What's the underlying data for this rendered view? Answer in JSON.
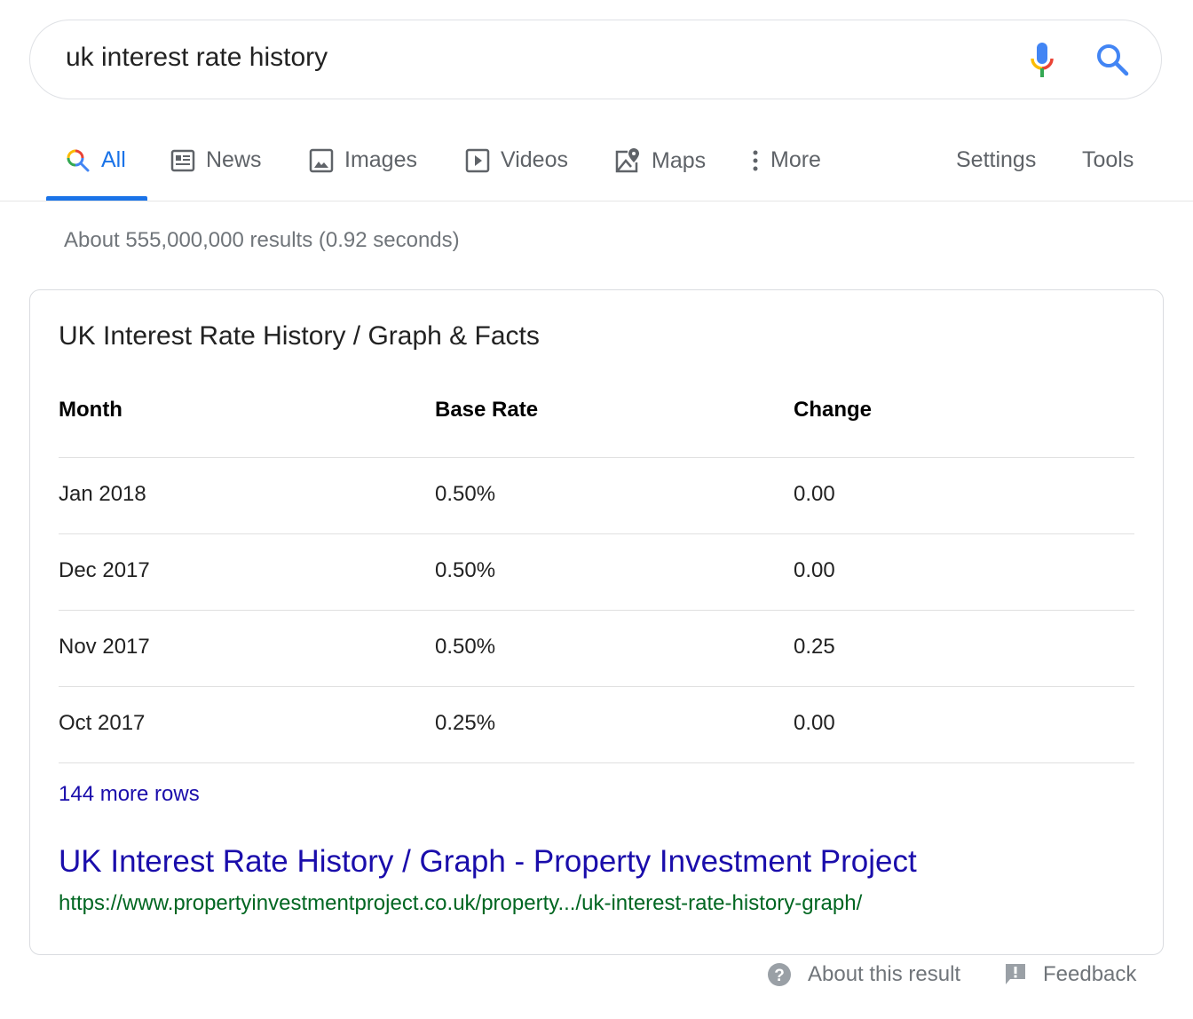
{
  "search": {
    "query": "uk interest rate history",
    "mic_icon": "microphone-icon",
    "search_icon": "search-icon"
  },
  "tabs": [
    {
      "label": "All",
      "icon": "search-icon",
      "active": true
    },
    {
      "label": "News",
      "icon": "newspaper-icon"
    },
    {
      "label": "Images",
      "icon": "image-icon"
    },
    {
      "label": "Videos",
      "icon": "play-icon"
    },
    {
      "label": "Maps",
      "icon": "map-pin-icon"
    },
    {
      "label": "More",
      "icon": "vertical-dots-icon"
    }
  ],
  "tools": {
    "settings": "Settings",
    "tools": "Tools"
  },
  "stats": "About 555,000,000 results (0.92 seconds)",
  "snippet": {
    "title": "UK Interest Rate History / Graph & Facts",
    "columns": [
      "Month",
      "Base Rate",
      "Change"
    ],
    "rows": [
      [
        "Jan 2018",
        "0.50%",
        "0.00"
      ],
      [
        "Dec 2017",
        "0.50%",
        "0.00"
      ],
      [
        "Nov 2017",
        "0.50%",
        "0.25"
      ],
      [
        "Oct 2017",
        "0.25%",
        "0.00"
      ]
    ],
    "more_rows": "144 more rows",
    "link_title": "UK Interest Rate History / Graph - Property Investment Project",
    "url": "https://www.propertyinvestmentproject.co.uk/property.../uk-interest-rate-history-graph/"
  },
  "footer": {
    "about": "About this result",
    "feedback": "Feedback"
  },
  "colors": {
    "accent": "#1a73e8",
    "link": "#1a0dab",
    "url": "#006621",
    "muted": "#70757a"
  }
}
